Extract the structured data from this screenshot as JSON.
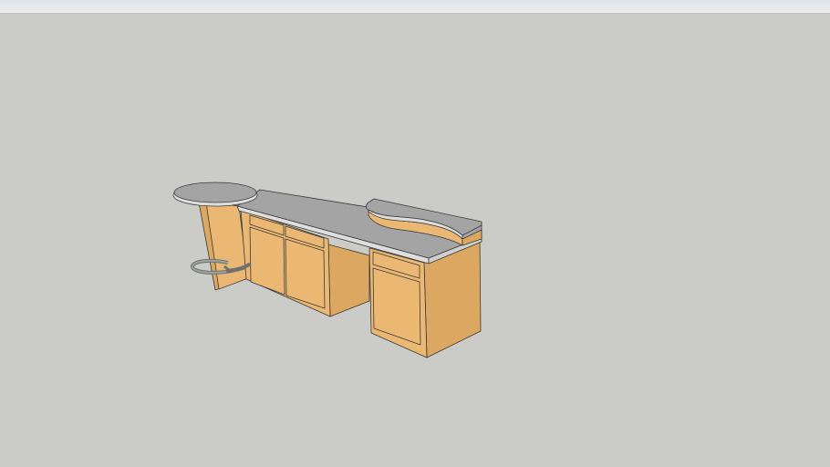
{
  "viewer": {
    "background_color": "#cbccc7",
    "wood_color": "#eab872",
    "wood_shade_color": "#dca861",
    "countertop_color": "#a4a4a4",
    "edge_color": "#dedede",
    "footrest_color": "#8a8c8c"
  }
}
